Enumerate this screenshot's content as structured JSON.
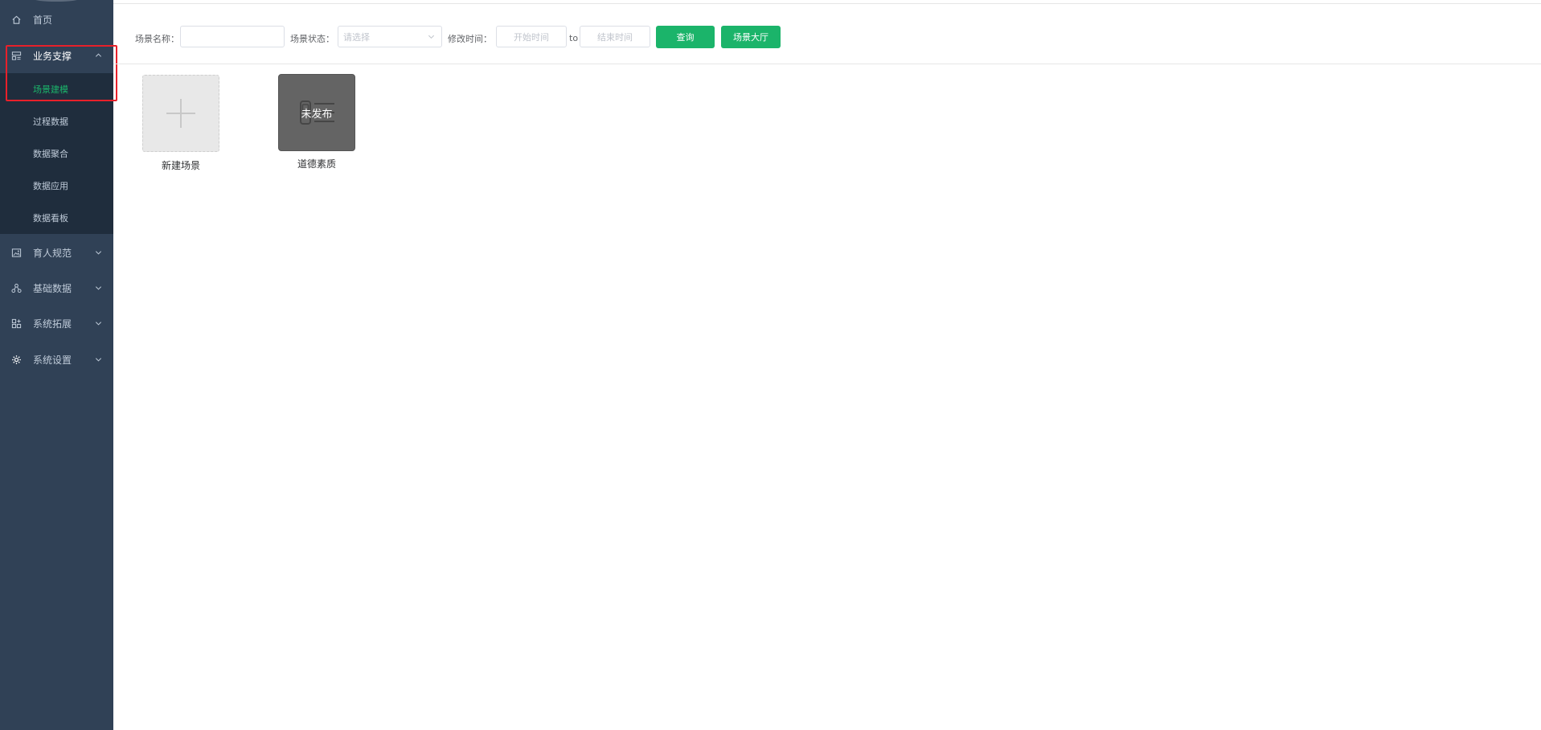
{
  "sidebar": {
    "home": "首页",
    "business": "业务支撑",
    "sub_items": [
      "场景建模",
      "过程数据",
      "数据聚合",
      "数据应用",
      "数据看板"
    ],
    "education": "育人规范",
    "base_data": "基础数据",
    "extension": "系统拓展",
    "settings": "系统设置"
  },
  "filter": {
    "name_label": "场景名称：",
    "name_value": "",
    "status_label": "场景状态：",
    "status_placeholder": "请选择",
    "time_label": "修改时间：",
    "start_placeholder": "开始时间",
    "to": "to",
    "end_placeholder": "结束时间",
    "query_button": "查询",
    "hall_button": "场景大厅"
  },
  "cards": {
    "new_label": "新建场景",
    "scene_status": "未发布",
    "scene_name": "道德素质"
  },
  "colors": {
    "sidebar_bg": "#304156",
    "submenu_bg": "#1f2d3d",
    "accent": "#1bb46a",
    "highlight": "#e8202a"
  }
}
